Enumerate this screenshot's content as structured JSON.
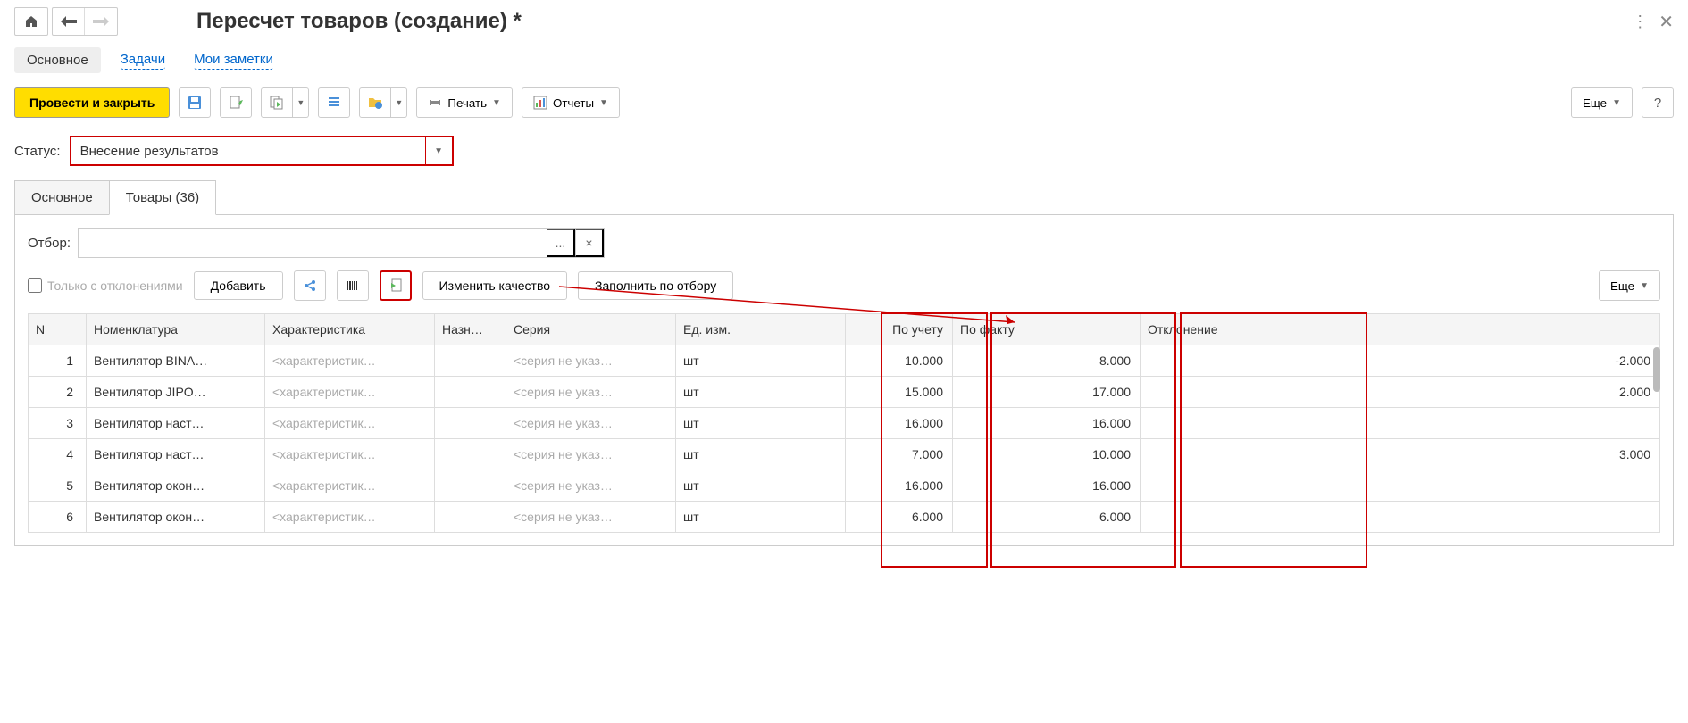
{
  "title": "Пересчет товаров (создание) *",
  "nav": {
    "main_tab": "Основное",
    "tasks_tab": "Задачи",
    "notes_tab": "Мои заметки"
  },
  "toolbar": {
    "post_close": "Провести и закрыть",
    "print": "Печать",
    "reports": "Отчеты",
    "more": "Еще",
    "help": "?"
  },
  "status": {
    "label": "Статус:",
    "value": "Внесение результатов"
  },
  "subtabs": {
    "main": "Основное",
    "goods": "Товары (36)"
  },
  "filter": {
    "label": "Отбор:",
    "value": "",
    "ellipsis": "...",
    "clear": "×"
  },
  "actions": {
    "only_deviations": "Только с отклонениями",
    "add": "Добавить",
    "change_quality": "Изменить качество",
    "fill_by_filter": "Заполнить по отбору",
    "more": "Еще"
  },
  "columns": {
    "n": "N",
    "nomenclature": "Номенклатура",
    "characteristic": "Характеристика",
    "naz": "Назн…",
    "series": "Серия",
    "unit": "Ед. изм.",
    "accounting": "По учету",
    "fact": "По факту",
    "deviation": "Отклонение"
  },
  "rows": [
    {
      "n": "1",
      "nom": "Вентилятор BINA…",
      "char": "<характеристик…",
      "naz": "",
      "ser": "<серия не указ…",
      "unit": "шт",
      "acc": "10.000",
      "fact": "8.000",
      "dev": "-2.000"
    },
    {
      "n": "2",
      "nom": "Вентилятор JIPO…",
      "char": "<характеристик…",
      "naz": "",
      "ser": "<серия не указ…",
      "unit": "шт",
      "acc": "15.000",
      "fact": "17.000",
      "dev": "2.000"
    },
    {
      "n": "3",
      "nom": "Вентилятор наст…",
      "char": "<характеристик…",
      "naz": "",
      "ser": "<серия не указ…",
      "unit": "шт",
      "acc": "16.000",
      "fact": "16.000",
      "dev": ""
    },
    {
      "n": "4",
      "nom": "Вентилятор наст…",
      "char": "<характеристик…",
      "naz": "",
      "ser": "<серия не указ…",
      "unit": "шт",
      "acc": "7.000",
      "fact": "10.000",
      "dev": "3.000"
    },
    {
      "n": "5",
      "nom": "Вентилятор окон…",
      "char": "<характеристик…",
      "naz": "",
      "ser": "<серия не указ…",
      "unit": "шт",
      "acc": "16.000",
      "fact": "16.000",
      "dev": ""
    },
    {
      "n": "6",
      "nom": "Вентилятор окон…",
      "char": "<характеристик…",
      "naz": "",
      "ser": "<серия не указ…",
      "unit": "шт",
      "acc": "6.000",
      "fact": "6.000",
      "dev": ""
    }
  ]
}
